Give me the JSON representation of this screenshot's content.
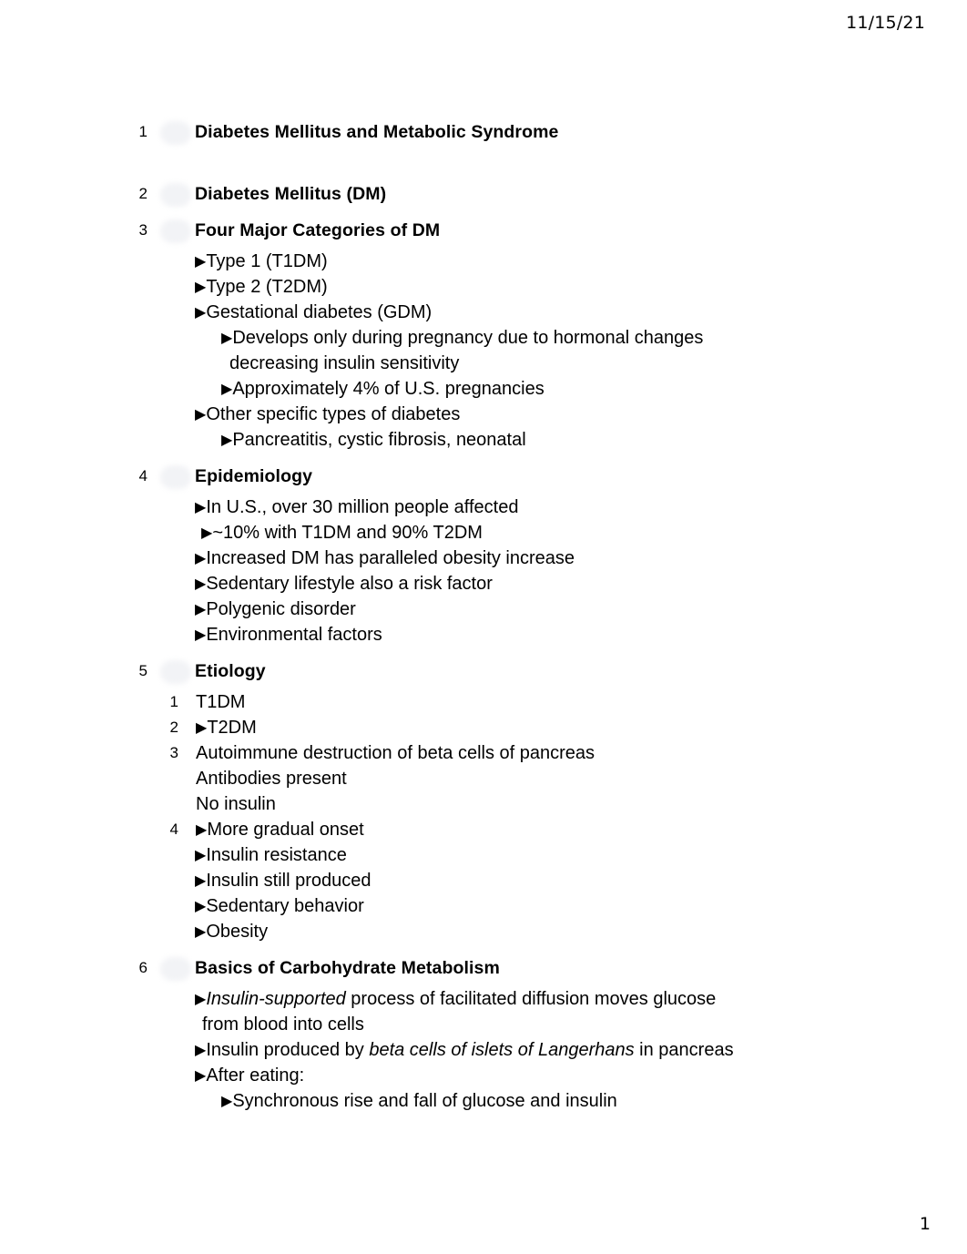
{
  "header": {
    "date": "11/15/21"
  },
  "footer": {
    "page_number": "1"
  },
  "bullet_glyph": "▶",
  "outline": {
    "slides": [
      {
        "number": "1",
        "title": "Diabetes Mellitus and Metabolic Syndrome",
        "lines": []
      },
      {
        "number": "2",
        "title": "Diabetes Mellitus (DM)",
        "lines": []
      },
      {
        "number": "3",
        "title": "Four Major Categories of DM",
        "lines": [
          {
            "level": 1,
            "bullet": true,
            "text": "Type 1 (T1DM)"
          },
          {
            "level": 1,
            "bullet": true,
            "text": "Type 2 (T2DM)"
          },
          {
            "level": 1,
            "bullet": true,
            "text": "Gestational diabetes (GDM)"
          },
          {
            "level": 2,
            "bullet": true,
            "text": "Develops only during pregnancy due to hormonal changes"
          },
          {
            "level": 2,
            "bullet": false,
            "wrap": true,
            "text": "decreasing insulin sensitivity"
          },
          {
            "level": 2,
            "bullet": true,
            "text": "Approximately 4% of U.S. pregnancies"
          },
          {
            "level": 1,
            "bullet": true,
            "text": "Other specific types of diabetes"
          },
          {
            "level": 2,
            "bullet": true,
            "text": "Pancreatitis, cystic fibrosis, neonatal"
          }
        ]
      },
      {
        "number": "4",
        "title": "Epidemiology",
        "lines": [
          {
            "level": 1,
            "bullet": true,
            "text": "In U.S., over 30 million people affected"
          },
          {
            "level": 1,
            "bullet": true,
            "nudge": true,
            "text": "~10% with T1DM and 90% T2DM"
          },
          {
            "level": 1,
            "bullet": true,
            "text": "Increased DM has paralleled obesity increase"
          },
          {
            "level": 1,
            "bullet": true,
            "text": "Sedentary lifestyle also a risk factor"
          },
          {
            "level": 1,
            "bullet": true,
            "text": "Polygenic disorder"
          },
          {
            "level": 1,
            "bullet": true,
            "text": "Environmental factors"
          }
        ]
      },
      {
        "number": "5",
        "title": "Etiology",
        "lines": [
          {
            "level": 1,
            "number": "1",
            "bullet": false,
            "text": "T1DM"
          },
          {
            "level": 1,
            "number": "2",
            "bullet": true,
            "text": "T2DM"
          },
          {
            "level": 1,
            "number": "3",
            "bullet": false,
            "text": "Autoimmune destruction of beta cells of pancreas"
          },
          {
            "level": 1,
            "bullet": false,
            "text": "Antibodies present"
          },
          {
            "level": 1,
            "bullet": false,
            "text": "No insulin"
          },
          {
            "level": 1,
            "number": "4",
            "bullet": true,
            "text": "More gradual onset"
          },
          {
            "level": 1,
            "bullet": true,
            "text": "Insulin resistance"
          },
          {
            "level": 1,
            "bullet": true,
            "text": "Insulin still produced"
          },
          {
            "level": 1,
            "bullet": true,
            "text": "Sedentary behavior"
          },
          {
            "level": 1,
            "bullet": true,
            "text": "Obesity"
          }
        ]
      },
      {
        "number": "6",
        "title": "Basics of Carbohydrate Metabolism",
        "lines": [
          {
            "level": 1,
            "bullet": true,
            "rich": [
              {
                "t": "Insulin-supported",
                "i": true
              },
              {
                "t": " process of facilitated diffusion moves glucose",
                "i": false
              }
            ]
          },
          {
            "level": 1,
            "bullet": false,
            "wrap": true,
            "text": "from blood into cells"
          },
          {
            "level": 1,
            "bullet": true,
            "rich": [
              {
                "t": "Insulin produced by ",
                "i": false
              },
              {
                "t": "beta cells of islets of Langerhans",
                "i": true
              },
              {
                "t": " in pancreas",
                "i": false
              }
            ]
          },
          {
            "level": 1,
            "bullet": true,
            "text": "After eating:"
          },
          {
            "level": 2,
            "bullet": true,
            "text": "Synchronous rise and fall of glucose and insulin"
          }
        ]
      }
    ]
  }
}
